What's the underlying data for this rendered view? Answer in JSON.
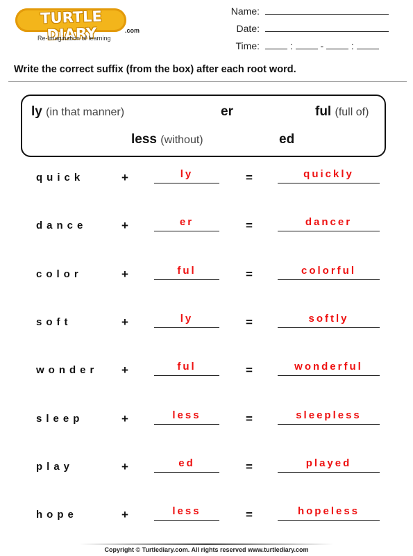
{
  "logo": {
    "brand": "TURTLE DIARY",
    "domain_suffix": ".com",
    "tagline": "Re-Imagination of learning",
    "brand_color": "#f3b51b"
  },
  "header": {
    "name_label": "Name:",
    "date_label": "Date:",
    "time_label": "Time:",
    "time_separators": [
      ":",
      "-",
      ":"
    ]
  },
  "instruction": "Write the correct suffix (from the box) after each root word.",
  "suffix_box": {
    "items": [
      {
        "suffix": "ly",
        "meaning": "(in that manner)"
      },
      {
        "suffix": "er",
        "meaning": ""
      },
      {
        "suffix": "ful",
        "meaning": "(full of)"
      },
      {
        "suffix": "less",
        "meaning": "(without)"
      },
      {
        "suffix": "ed",
        "meaning": ""
      }
    ]
  },
  "operators": {
    "plus": "+",
    "equals": "="
  },
  "answer_color": "#ee1111",
  "rows": [
    {
      "root": "quick",
      "suffix": "ly",
      "result": "quickly"
    },
    {
      "root": "dance",
      "suffix": "er",
      "result": "dancer"
    },
    {
      "root": "color",
      "suffix": "ful",
      "result": "colorful"
    },
    {
      "root": "soft",
      "suffix": "ly",
      "result": "softly"
    },
    {
      "root": "wonder",
      "suffix": "ful",
      "result": "wonderful"
    },
    {
      "root": "sleep",
      "suffix": "less",
      "result": "sleepless"
    },
    {
      "root": "play",
      "suffix": "ed",
      "result": "played"
    },
    {
      "root": "hope",
      "suffix": "less",
      "result": "hopeless"
    }
  ],
  "footer": "Copyright © Turtlediary.com. All rights reserved  www.turtlediary.com"
}
